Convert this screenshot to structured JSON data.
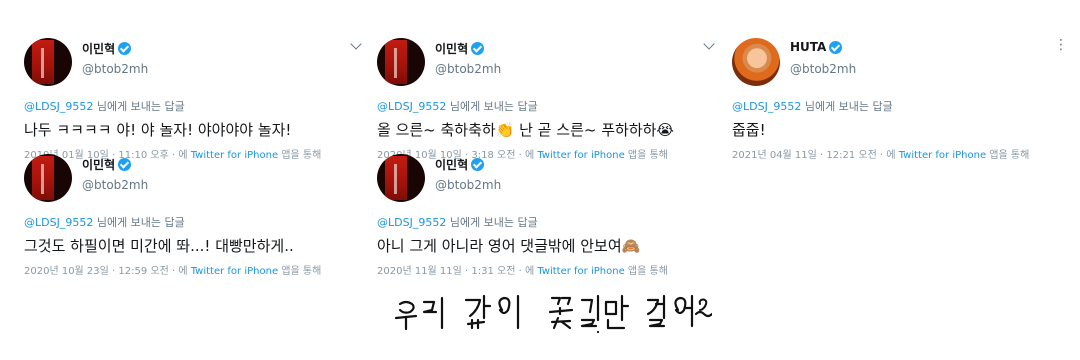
{
  "tweets": [
    {
      "name": "이민혁",
      "handle": "@btob2mh",
      "reply_to": "@LDSJ_9552",
      "reply_suffix": " 님에게 보내는 답글",
      "text": "나두 ㅋㅋㅋㅋ 야! 야 놀자! 야야야야 놀자!",
      "timestamp": "2019년 01월 10일 · 11:10 오후 · 에 ",
      "source": "Twitter for iPhone",
      "source_suffix": " 앱을 통해"
    },
    {
      "name": "이민혁",
      "handle": "@btob2mh",
      "reply_to": "@LDSJ_9552",
      "reply_suffix": " 님에게 보내는 답글",
      "text": "그것도 하필이면 미간에 똬...! 대빵만하게..",
      "timestamp": "2020년 10월 23일 · 12:59 오전 · 에 ",
      "source": "Twitter for iPhone",
      "source_suffix": " 앱을 통해"
    },
    {
      "name": "이민혁",
      "handle": "@btob2mh",
      "reply_to": "@LDSJ_9552",
      "reply_suffix": " 님에게 보내는 답글",
      "text": "올 으른~ 축하축하👏 난 곧 스른~ 푸하하하😭",
      "timestamp": "2020년 10월 10일 · 3:18 오전 · 에 ",
      "source": "Twitter for iPhone",
      "source_suffix": " 앱을 통해"
    },
    {
      "name": "이민혁",
      "handle": "@btob2mh",
      "reply_to": "@LDSJ_9552",
      "reply_suffix": " 님에게 보내는 답글",
      "text": "아니 그게 아니라 영어 댓글밖에 안보여🙈",
      "timestamp": "2020년 11월 11일 · 1:31 오전 · 에 ",
      "source": "Twitter for iPhone",
      "source_suffix": " 앱을 통해"
    },
    {
      "name": "HUTA",
      "handle": "@btob2mh",
      "reply_to": "@LDSJ_9552",
      "reply_suffix": " 님에게 보내는 답글",
      "text": "줍줍!",
      "timestamp": "2021년 04월 11일 · 12:21 오전 · 에 ",
      "source": "Twitter for iPhone",
      "source_suffix": " 앱을 통해"
    }
  ],
  "signature": "우리 같이 꽃길만 걸어요~♡",
  "icons": {
    "verified": "verified-badge-icon",
    "menu": "chevron-down-icon",
    "more": "more-vertical-icon"
  },
  "colors": {
    "link": "#1b95e0",
    "verified": "#1da1f2",
    "muted": "#657786"
  }
}
